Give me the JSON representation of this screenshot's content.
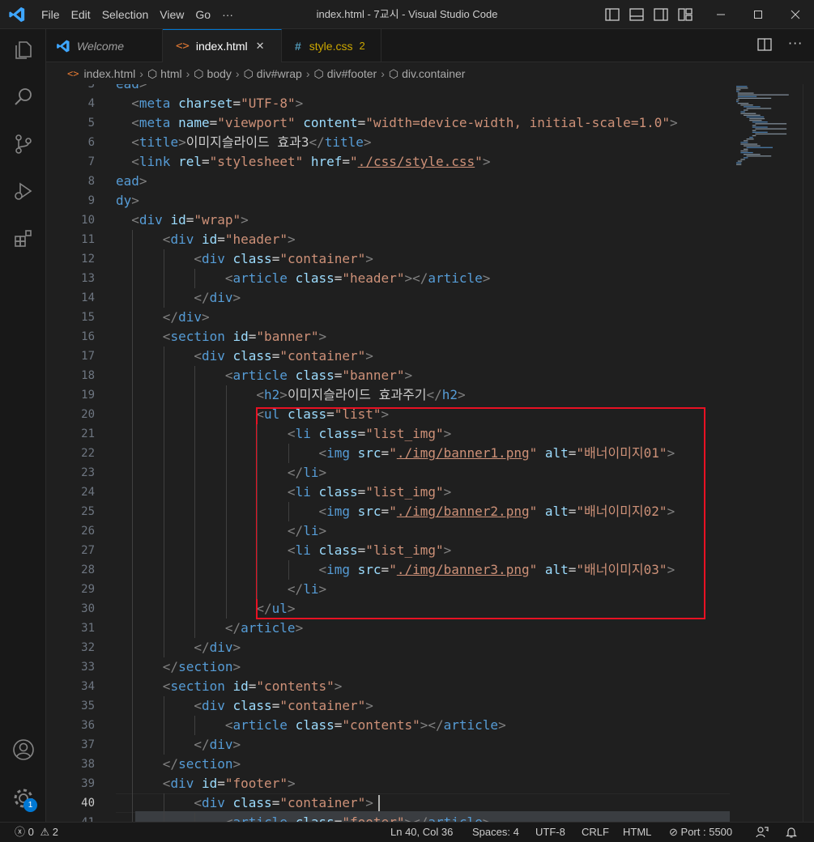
{
  "window": {
    "title": "index.html - 7교시 - Visual Studio Code"
  },
  "menu": [
    "File",
    "Edit",
    "Selection",
    "View",
    "Go",
    "···"
  ],
  "tabs": [
    {
      "label": "Welcome",
      "icon": "vscode-icon"
    },
    {
      "label": "index.html",
      "icon": "html-icon",
      "active": true,
      "close": "✕"
    },
    {
      "label": "style.css",
      "icon": "css-icon",
      "badge": "2"
    }
  ],
  "breadcrumb": [
    "index.html",
    "html",
    "body",
    "div#wrap",
    "div#footer",
    "div.container"
  ],
  "editor": {
    "lines": [
      {
        "n": "3",
        "text": "ead>"
      },
      {
        "n": "4",
        "text": "  <meta charset=\"UTF-8\">"
      },
      {
        "n": "5",
        "text": "  <meta name=\"viewport\" content=\"width=device-width, initial-scale=1.0\">"
      },
      {
        "n": "6",
        "text": "  <title>이미지슬라이드 효과3</title>"
      },
      {
        "n": "7",
        "text": "  <link rel=\"stylesheet\" href=\"./css/style.css\">"
      },
      {
        "n": "8",
        "text": "ead>"
      },
      {
        "n": "9",
        "text": "dy>"
      },
      {
        "n": "10",
        "text": "  <div id=\"wrap\">"
      },
      {
        "n": "11",
        "text": "      <div id=\"header\">"
      },
      {
        "n": "12",
        "text": "          <div class=\"container\">"
      },
      {
        "n": "13",
        "text": "              <article class=\"header\"></article>"
      },
      {
        "n": "14",
        "text": "          </div>"
      },
      {
        "n": "15",
        "text": "      </div>"
      },
      {
        "n": "16",
        "text": "      <section id=\"banner\">"
      },
      {
        "n": "17",
        "text": "          <div class=\"container\">"
      },
      {
        "n": "18",
        "text": "              <article class=\"banner\">"
      },
      {
        "n": "19",
        "text": "                  <h2>이미지슬라이드 효과주기</h2>"
      },
      {
        "n": "20",
        "text": "                  <ul class=\"list\">"
      },
      {
        "n": "21",
        "text": "                      <li class=\"list_img\">"
      },
      {
        "n": "22",
        "text": "                          <img src=\"./img/banner1.png\" alt=\"배너이미지01\">"
      },
      {
        "n": "23",
        "text": "                      </li>"
      },
      {
        "n": "24",
        "text": "                      <li class=\"list_img\">"
      },
      {
        "n": "25",
        "text": "                          <img src=\"./img/banner2.png\" alt=\"배너이미지02\">"
      },
      {
        "n": "26",
        "text": "                      </li>"
      },
      {
        "n": "27",
        "text": "                      <li class=\"list_img\">"
      },
      {
        "n": "28",
        "text": "                          <img src=\"./img/banner3.png\" alt=\"배너이미지03\">"
      },
      {
        "n": "29",
        "text": "                      </li>"
      },
      {
        "n": "30",
        "text": "                  </ul>"
      },
      {
        "n": "31",
        "text": "              </article>"
      },
      {
        "n": "32",
        "text": "          </div>"
      },
      {
        "n": "33",
        "text": "      </section>"
      },
      {
        "n": "34",
        "text": "      <section id=\"contents\">"
      },
      {
        "n": "35",
        "text": "          <div class=\"container\">"
      },
      {
        "n": "36",
        "text": "              <article class=\"contents\"></article>"
      },
      {
        "n": "37",
        "text": "          </div>"
      },
      {
        "n": "38",
        "text": "      </section>"
      },
      {
        "n": "39",
        "text": "      <div id=\"footer\">"
      },
      {
        "n": "40",
        "text": "          <div class=\"container\">"
      },
      {
        "n": "41",
        "text": "              <article class=\"footer\"></article>"
      }
    ]
  },
  "accounts_badge": "1",
  "status": {
    "errors": "0",
    "warnings": "2",
    "position": "Ln 40, Col 36",
    "spaces": "Spaces: 4",
    "encoding": "UTF-8",
    "eol": "CRLF",
    "language": "HTML",
    "port": "Port : 5500"
  },
  "colors": {
    "accent": "#0078d4",
    "highlight_box": "#e81123",
    "tag": "#569cd6",
    "attr": "#9cdcfe",
    "string": "#ce9178"
  }
}
